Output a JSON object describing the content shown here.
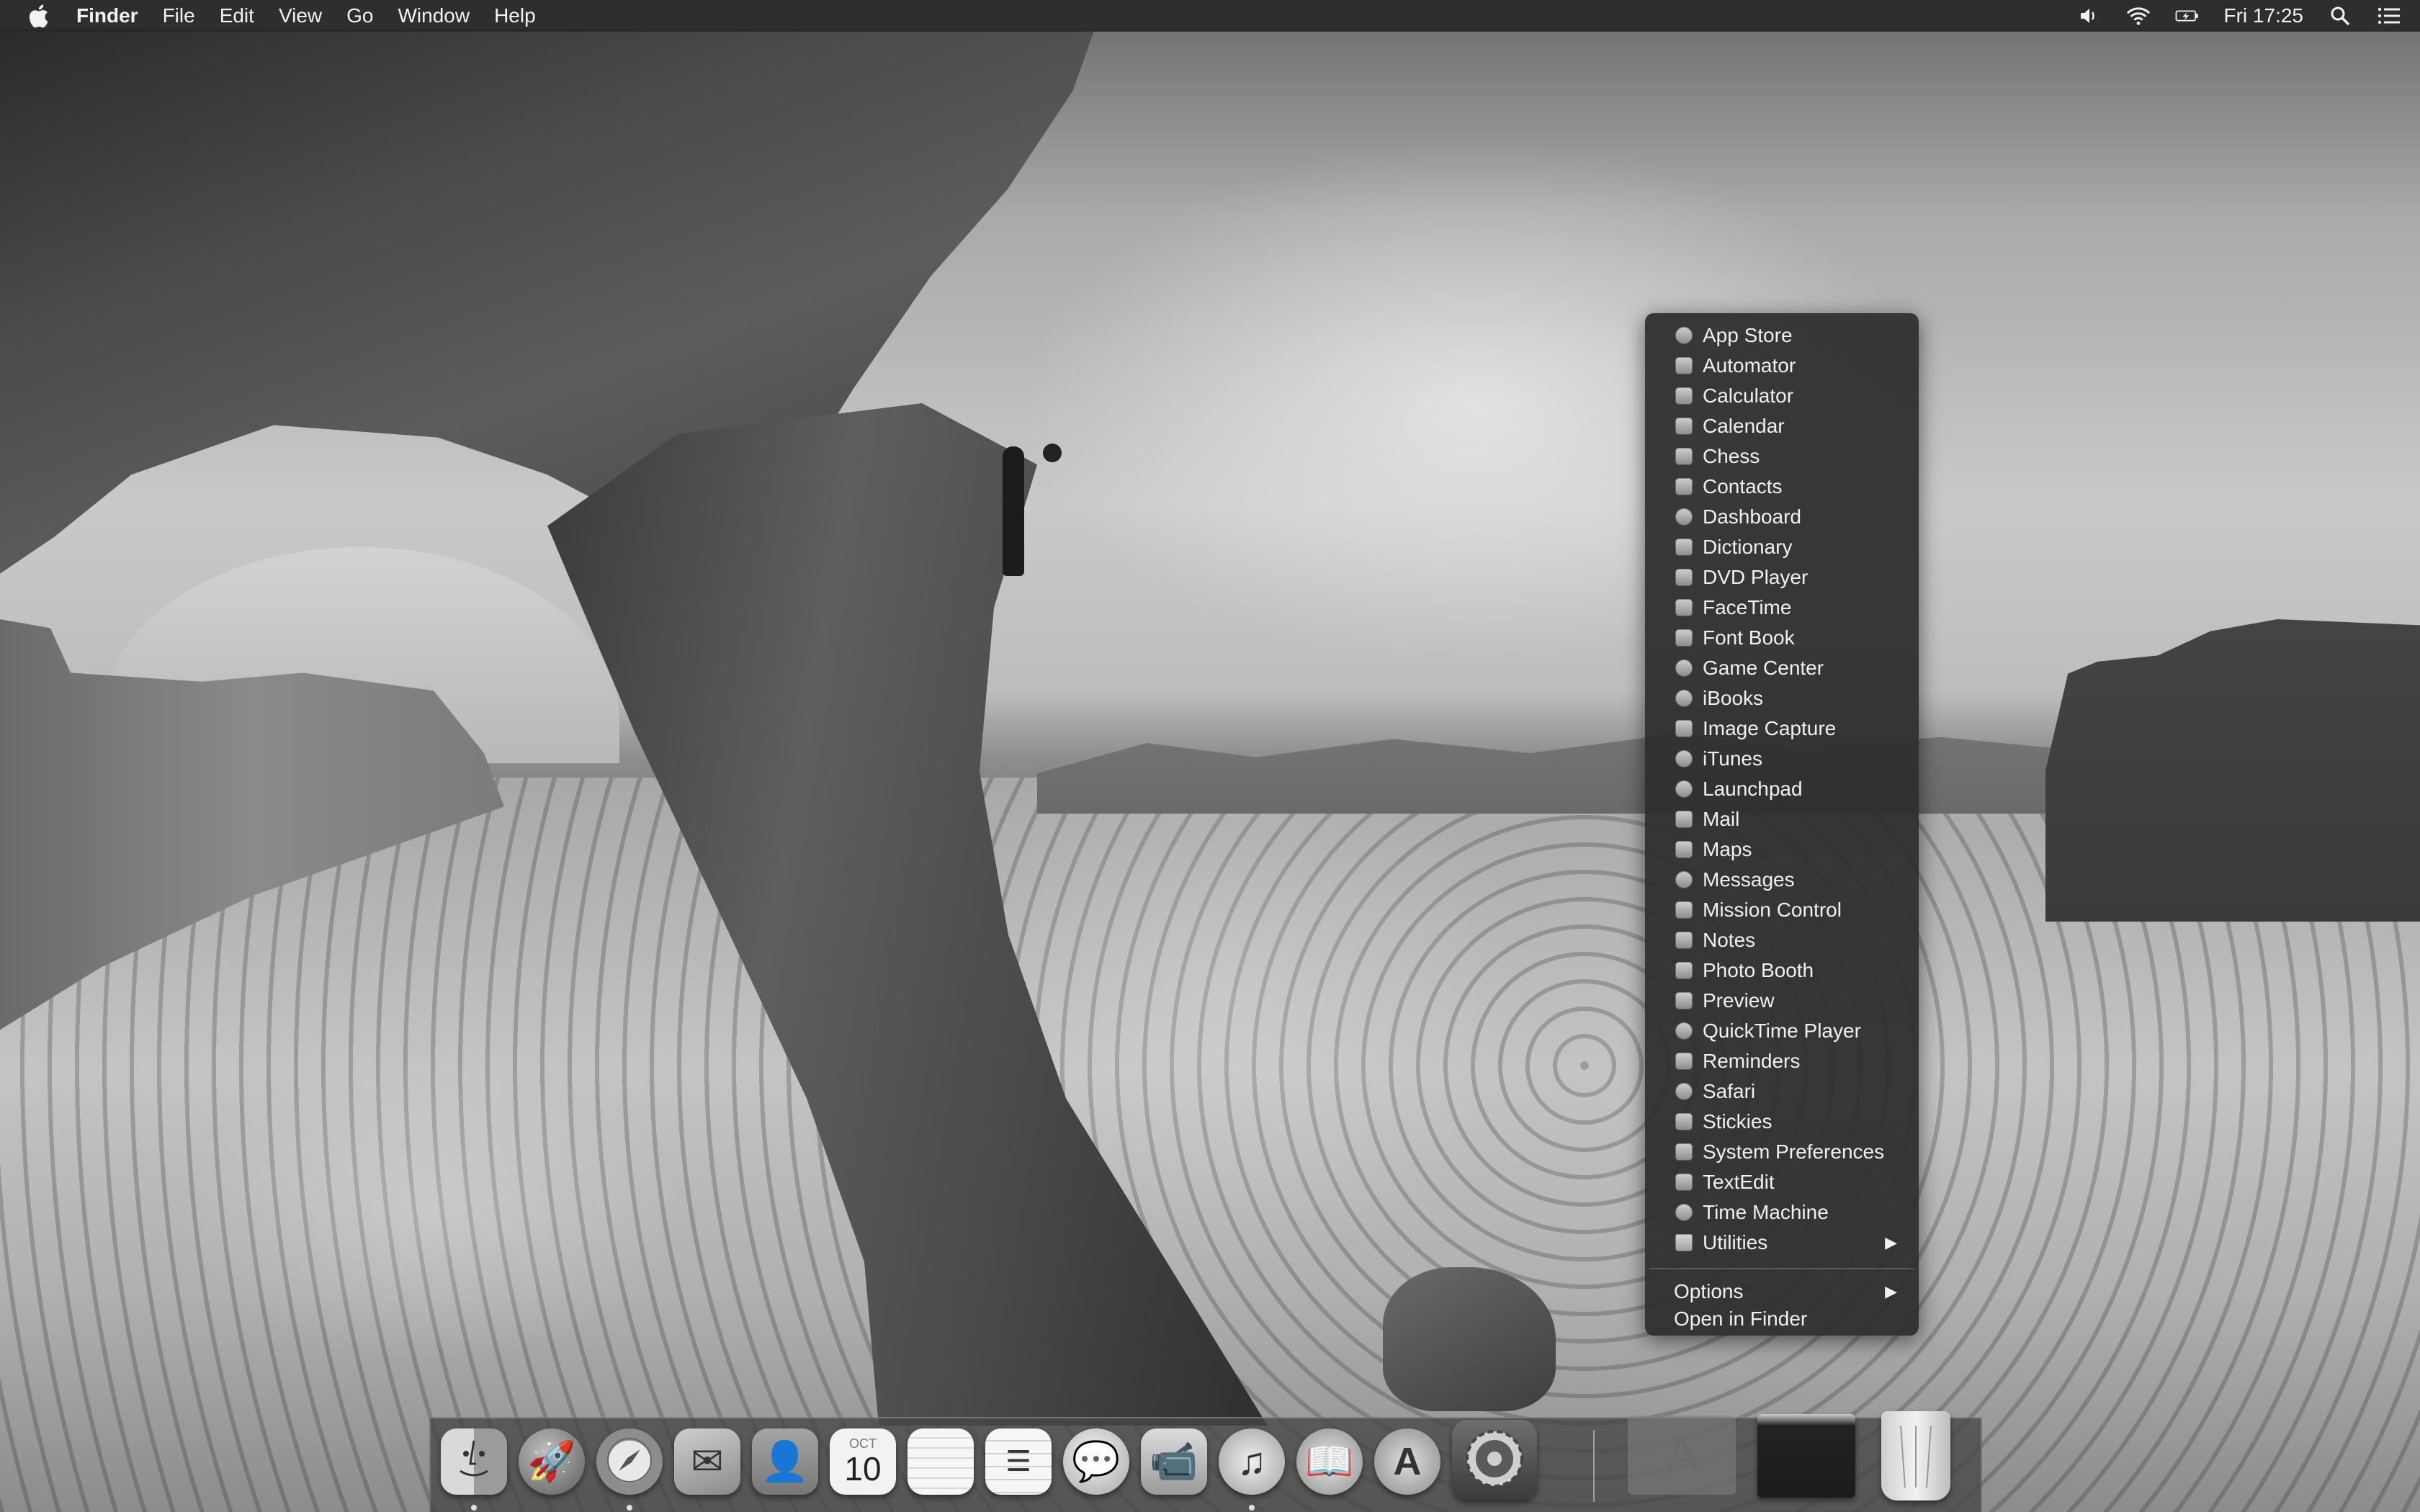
{
  "menubar": {
    "app_name": "Finder",
    "menus": [
      "File",
      "Edit",
      "View",
      "Go",
      "Window",
      "Help"
    ],
    "status": {
      "volume_icon": "speaker-icon",
      "wifi_icon": "wifi-icon",
      "battery_icon": "battery-charging-icon",
      "clock": "Fri 17:25",
      "spotlight_icon": "search-icon",
      "notification_icon": "list-icon"
    }
  },
  "stack_menu": {
    "items": [
      {
        "label": "App Store",
        "icon": "app-store-icon"
      },
      {
        "label": "Automator",
        "icon": "automator-icon"
      },
      {
        "label": "Calculator",
        "icon": "calculator-icon"
      },
      {
        "label": "Calendar",
        "icon": "calendar-icon"
      },
      {
        "label": "Chess",
        "icon": "chess-icon"
      },
      {
        "label": "Contacts",
        "icon": "contacts-icon"
      },
      {
        "label": "Dashboard",
        "icon": "dashboard-icon"
      },
      {
        "label": "Dictionary",
        "icon": "dictionary-icon"
      },
      {
        "label": "DVD Player",
        "icon": "dvd-player-icon"
      },
      {
        "label": "FaceTime",
        "icon": "facetime-icon"
      },
      {
        "label": "Font Book",
        "icon": "font-book-icon"
      },
      {
        "label": "Game Center",
        "icon": "game-center-icon"
      },
      {
        "label": "iBooks",
        "icon": "ibooks-icon"
      },
      {
        "label": "Image Capture",
        "icon": "image-capture-icon"
      },
      {
        "label": "iTunes",
        "icon": "itunes-icon"
      },
      {
        "label": "Launchpad",
        "icon": "launchpad-icon"
      },
      {
        "label": "Mail",
        "icon": "mail-icon"
      },
      {
        "label": "Maps",
        "icon": "maps-icon"
      },
      {
        "label": "Messages",
        "icon": "messages-icon"
      },
      {
        "label": "Mission Control",
        "icon": "mission-control-icon"
      },
      {
        "label": "Notes",
        "icon": "notes-icon"
      },
      {
        "label": "Photo Booth",
        "icon": "photo-booth-icon"
      },
      {
        "label": "Preview",
        "icon": "preview-icon"
      },
      {
        "label": "QuickTime Player",
        "icon": "quicktime-icon"
      },
      {
        "label": "Reminders",
        "icon": "reminders-icon"
      },
      {
        "label": "Safari",
        "icon": "safari-icon"
      },
      {
        "label": "Stickies",
        "icon": "stickies-icon"
      },
      {
        "label": "System Preferences",
        "icon": "system-preferences-icon"
      },
      {
        "label": "TextEdit",
        "icon": "textedit-icon"
      },
      {
        "label": "Time Machine",
        "icon": "time-machine-icon"
      },
      {
        "label": "Utilities",
        "icon": "folder-icon",
        "submenu": true
      }
    ],
    "options_label": "Options",
    "open_in_finder_label": "Open in Finder"
  },
  "dock": {
    "items": [
      {
        "name": "finder",
        "icon": "finder-icon",
        "running": true
      },
      {
        "name": "launchpad",
        "icon": "launchpad-icon",
        "running": false
      },
      {
        "name": "safari",
        "icon": "safari-icon",
        "running": true
      },
      {
        "name": "mail",
        "icon": "mail-stamp-icon",
        "running": false
      },
      {
        "name": "contacts",
        "icon": "contacts-icon",
        "running": false
      },
      {
        "name": "calendar",
        "icon": "calendar-icon",
        "running": false,
        "month": "OCT",
        "day": "10"
      },
      {
        "name": "notes",
        "icon": "notes-icon",
        "running": false
      },
      {
        "name": "reminders",
        "icon": "reminders-icon",
        "running": false
      },
      {
        "name": "messages",
        "icon": "messages-icon",
        "running": false
      },
      {
        "name": "facetime",
        "icon": "facetime-icon",
        "running": false
      },
      {
        "name": "itunes",
        "icon": "itunes-icon",
        "running": true
      },
      {
        "name": "ibooks",
        "icon": "ibooks-icon",
        "running": false
      },
      {
        "name": "app-store",
        "icon": "app-store-icon",
        "running": false
      },
      {
        "name": "system-preferences",
        "icon": "gear-icon",
        "running": false
      },
      {
        "name": "applications-stack",
        "icon": "applications-folder-icon",
        "running": false
      },
      {
        "name": "downloads-stack",
        "icon": "downloads-stack-icon",
        "running": false
      },
      {
        "name": "trash",
        "icon": "trash-icon",
        "running": false
      }
    ]
  },
  "colors": {
    "menubar_bg": "#282828",
    "menu_bg": "#2e2e2e",
    "menu_text": "#f0f0f0"
  }
}
